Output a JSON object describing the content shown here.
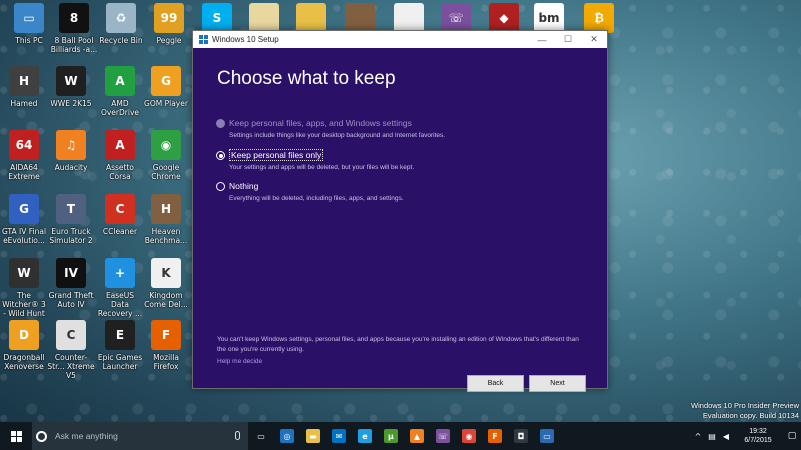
{
  "desktop": {
    "icons": [
      {
        "label": "This PC",
        "icon": "computer-icon",
        "color": "#3a86c8",
        "glyph": "▭"
      },
      {
        "label": "8 Ball Pool Billiards -a...",
        "icon": "eight-ball-icon",
        "color": "#111111",
        "glyph": "8"
      },
      {
        "label": "Recycle Bin",
        "icon": "recycle-bin-icon",
        "color": "#9ab4c8",
        "glyph": "♻"
      },
      {
        "label": "Peggle",
        "icon": "peggle-icon",
        "color": "#e0a020",
        "glyph": "99"
      },
      {
        "label": "Skype",
        "icon": "skype-icon",
        "color": "#00aff0",
        "glyph": "S"
      },
      {
        "label": "",
        "icon": "file-icon",
        "color": "#e8d8a0",
        "glyph": ""
      },
      {
        "label": "",
        "icon": "folder-icon",
        "color": "#e8c048",
        "glyph": ""
      },
      {
        "label": "",
        "icon": "game-cover-icon",
        "color": "#806040",
        "glyph": ""
      },
      {
        "label": "",
        "icon": "document-icon",
        "color": "#f0f0f0",
        "glyph": ""
      },
      {
        "label": "",
        "icon": "viber-icon",
        "color": "#7b519d",
        "glyph": "☏"
      },
      {
        "label": "",
        "icon": "app-icon",
        "color": "#b02020",
        "glyph": "◆"
      },
      {
        "label": "",
        "icon": "bmw-icon",
        "color": "#ffffff",
        "glyph": "bm"
      },
      {
        "label": "",
        "icon": "bitcoin-icon",
        "color": "#f2a900",
        "glyph": "₿"
      },
      {
        "label": "Hamed",
        "icon": "user-folder-icon",
        "color": "#404040",
        "glyph": "H"
      },
      {
        "label": "WWE 2K15",
        "icon": "wwe-icon",
        "color": "#202020",
        "glyph": "W"
      },
      {
        "label": "AMD OverDrive",
        "icon": "amd-icon",
        "color": "#20a040",
        "glyph": "A"
      },
      {
        "label": "GOM Player",
        "icon": "gom-player-icon",
        "color": "#f0a020",
        "glyph": "G"
      },
      {
        "label": "AIDA64 Extreme",
        "icon": "aida64-icon",
        "color": "#c02020",
        "glyph": "64"
      },
      {
        "label": "Audacity",
        "icon": "audacity-icon",
        "color": "#f08020",
        "glyph": "♫"
      },
      {
        "label": "Assetto Corsa",
        "icon": "assetto-corsa-icon",
        "color": "#c02020",
        "glyph": "A"
      },
      {
        "label": "Google Chrome",
        "icon": "chrome-icon",
        "color": "#2ea043",
        "glyph": "◉"
      },
      {
        "label": "GTA IV Final eEvolutio...",
        "icon": "gta-icon",
        "color": "#3060c0",
        "glyph": "G"
      },
      {
        "label": "Euro Truck Simulator 2",
        "icon": "truck-icon",
        "color": "#506080",
        "glyph": "T"
      },
      {
        "label": "CCleaner",
        "icon": "ccleaner-icon",
        "color": "#d03020",
        "glyph": "C"
      },
      {
        "label": "Heaven Benchma...",
        "icon": "heaven-icon",
        "color": "#806040",
        "glyph": "H"
      },
      {
        "label": "The Witcher® 3 - Wild Hunt",
        "icon": "witcher-icon",
        "color": "#303030",
        "glyph": "W"
      },
      {
        "label": "Grand Theft Auto IV",
        "icon": "gta4-icon",
        "color": "#101010",
        "glyph": "IV"
      },
      {
        "label": "EaseUS Data Recovery ...",
        "icon": "easeus-icon",
        "color": "#2090e0",
        "glyph": "+"
      },
      {
        "label": "Kingdom Come Del...",
        "icon": "kingdom-come-icon",
        "color": "#f0f0f0",
        "glyph": "K"
      },
      {
        "label": "Dragonball Xenoverse",
        "icon": "dragonball-icon",
        "color": "#f0a020",
        "glyph": "D"
      },
      {
        "label": "Counter-Str... Xtreme V5",
        "icon": "counter-strike-icon",
        "color": "#e0e0e0",
        "glyph": "C"
      },
      {
        "label": "Epic Games Launcher",
        "icon": "epic-games-icon",
        "color": "#202020",
        "glyph": "E"
      },
      {
        "label": "Mozilla Firefox",
        "icon": "firefox-icon",
        "color": "#e66000",
        "glyph": "F"
      }
    ]
  },
  "window": {
    "title": "Windows 10 Setup",
    "heading": "Choose what to keep",
    "options": [
      {
        "label": "Keep personal files, apps, and Windows settings",
        "desc": "Settings include things like your desktop background and Internet favorites.",
        "state": "disabled"
      },
      {
        "label": "Keep personal files only",
        "desc": "Your settings and apps will be deleted, but your files will be kept.",
        "state": "checked"
      },
      {
        "label": "Nothing",
        "desc": "Everything will be deleted, including files, apps, and settings.",
        "state": "unchecked"
      }
    ],
    "note": "You can't keep Windows settings, personal files, and apps because you're installing an edition of Windows that's different than the one you're currently using.",
    "help_link": "Help me decide",
    "back_label": "Back",
    "next_label": "Next",
    "controls": {
      "minimize": "—",
      "maximize": "☐",
      "close": "✕"
    }
  },
  "taskbar": {
    "search_placeholder": "Ask me anything",
    "pinned": [
      {
        "icon": "task-view-icon",
        "color": "#101820",
        "glyph": "▭"
      },
      {
        "icon": "store-globe-icon",
        "color": "#1e73be",
        "glyph": "◎"
      },
      {
        "icon": "file-explorer-icon",
        "color": "#e8c048",
        "glyph": "▬"
      },
      {
        "icon": "outlook-icon",
        "color": "#0072c6",
        "glyph": "✉"
      },
      {
        "icon": "edge-ie-icon",
        "color": "#1ea0e0",
        "glyph": "e"
      },
      {
        "icon": "utorrent-icon",
        "color": "#4a9a2a",
        "glyph": "μ"
      },
      {
        "icon": "vlc-icon",
        "color": "#f08020",
        "glyph": "▲"
      },
      {
        "icon": "viber-icon",
        "color": "#7b519d",
        "glyph": "☏"
      },
      {
        "icon": "chrome-icon",
        "color": "#db4437",
        "glyph": "◉"
      },
      {
        "icon": "firefox-icon",
        "color": "#e66000",
        "glyph": "F"
      },
      {
        "icon": "media-icon",
        "color": "#303840",
        "glyph": "◘"
      },
      {
        "icon": "setup-icon",
        "color": "#2a6ab0",
        "glyph": "▭"
      }
    ],
    "time": "19:32",
    "date": "6/7/2015"
  },
  "watermark": {
    "line1": "Windows 10 Pro Insider Preview",
    "line2": "Evaluation copy. Build 10134"
  }
}
